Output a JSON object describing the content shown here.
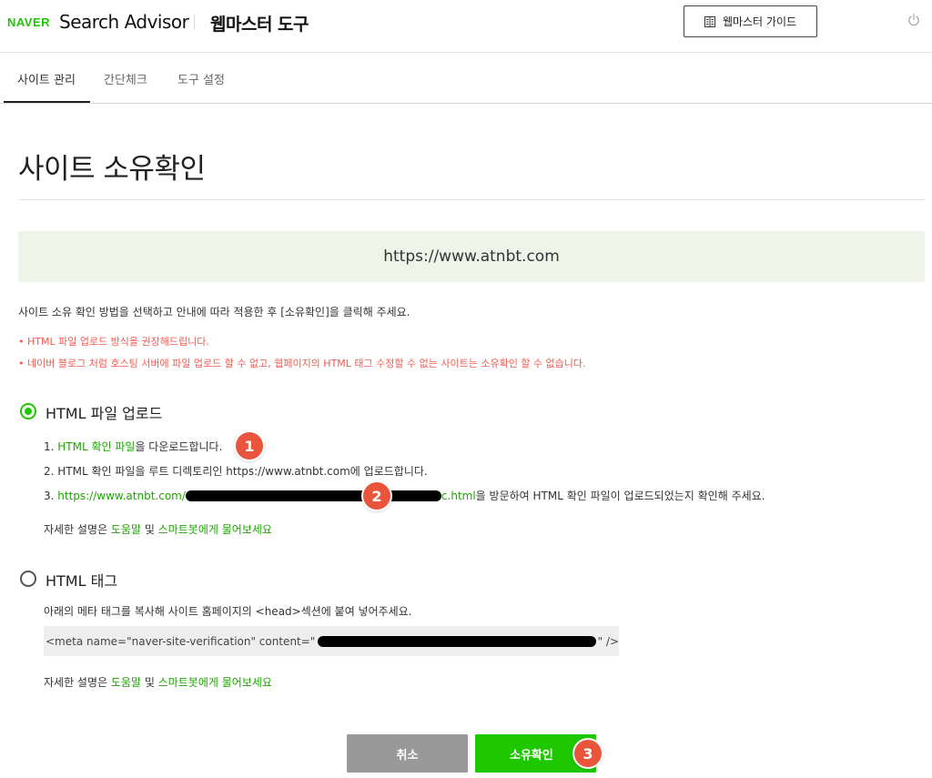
{
  "header": {
    "brand": "NAVER",
    "app_title": "Search Advisor",
    "tool_title": "웹마스터 도구",
    "guide_label": "웹마스터 가이드"
  },
  "tabs": [
    {
      "label": "사이트 관리",
      "active": true
    },
    {
      "label": "간단체크",
      "active": false
    },
    {
      "label": "도구 설정",
      "active": false
    }
  ],
  "page": {
    "title": "사이트 소유확인",
    "site_url": "https://www.atnbt.com",
    "instruction": "사이트 소유 확인 방법을 선택하고 안내에 따라 적용한 후 [소유확인]을 클릭해 주세요.",
    "notices": [
      "• HTML 파일 업로드 방식을 권장해드립니다.",
      "• 네이버 블로그 처럼 호스팅 서버에 파일 업로드 할 수 없고, 웹페이지의 HTML 태그 수정할 수 없는 사이트는 소유확인 할 수 없습니다."
    ]
  },
  "option_file": {
    "label": "HTML 파일 업로드",
    "selected": true,
    "step1_prefix": "1. ",
    "step1_link": "HTML 확인 파일",
    "step1_suffix": "을 다운로드합니다.",
    "step2": "2. HTML 확인 파일을 루트 디렉토리인 https://www.atnbt.com에 업로드합니다.",
    "step3_prefix": "3. ",
    "step3_link_start": "https://www.atnbt.com/",
    "step3_link_end": "c.html",
    "step3_suffix": "을 방문하여 HTML 확인 파일이 업로드되었는지 확인해 주세요.",
    "help_prefix": "자세한 설명은 ",
    "help_link1": "도움말",
    "help_mid": " 및 ",
    "help_link2": "스마트봇에게 물어보세요"
  },
  "option_tag": {
    "label": "HTML 태그",
    "selected": false,
    "description": "아래의 메타 태그를 복사해 사이트 홈페이지의 <head>섹션에 붙여 넣어주세요.",
    "code_prefix": "<meta name=\"naver-site-verification\" content=\"",
    "code_suffix": "\" />",
    "help_prefix": "자세한 설명은 ",
    "help_link1": "도움말",
    "help_mid": " 및 ",
    "help_link2": "스마트봇에게 물어보세요"
  },
  "annotations": [
    "1",
    "2",
    "3"
  ],
  "buttons": {
    "cancel": "취소",
    "confirm": "소유확인"
  },
  "colors": {
    "brand_green": "#1ec800",
    "link_green": "#1ca800",
    "notice_red": "#f05a50",
    "banner_bg": "#eef5e8",
    "badge": "#e8553c",
    "cancel_gray": "#999999"
  }
}
